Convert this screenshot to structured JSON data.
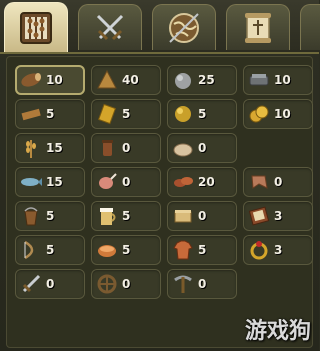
{
  "tabs": [
    {
      "name": "abacus",
      "active": true
    },
    {
      "name": "crossed-swords",
      "active": false
    },
    {
      "name": "globe",
      "active": false
    },
    {
      "name": "scroll",
      "active": false
    }
  ],
  "resources": [
    {
      "icon": "log-icon",
      "value": "10"
    },
    {
      "icon": "hide-icon",
      "value": "40"
    },
    {
      "icon": "stone-icon",
      "value": "25"
    },
    {
      "icon": "iron-icon",
      "value": "10"
    },
    {
      "icon": "plank-icon",
      "value": "5"
    },
    {
      "icon": "gold-bar-icon",
      "value": "5"
    },
    {
      "icon": "gold-ore-icon",
      "value": "5"
    },
    {
      "icon": "coins-icon",
      "value": "10"
    },
    {
      "icon": "wheat-icon",
      "value": "15"
    },
    {
      "icon": "hops-icon",
      "value": "0"
    },
    {
      "icon": "flour-icon",
      "value": "0"
    },
    {
      "icon": "fish-icon",
      "value": "15"
    },
    {
      "icon": "ham-icon",
      "value": "0"
    },
    {
      "icon": "sausage-icon",
      "value": "20"
    },
    {
      "icon": "meat-icon",
      "value": "0"
    },
    {
      "icon": "bucket-icon",
      "value": "5"
    },
    {
      "icon": "beer-icon",
      "value": "5"
    },
    {
      "icon": "cheese-icon",
      "value": "0"
    },
    {
      "icon": "book-icon",
      "value": "3"
    },
    {
      "icon": "bow-icon",
      "value": "5"
    },
    {
      "icon": "pastry-icon",
      "value": "5"
    },
    {
      "icon": "tunic-icon",
      "value": "5"
    },
    {
      "icon": "ring-icon",
      "value": "3"
    },
    {
      "icon": "sword-icon",
      "value": "0"
    },
    {
      "icon": "wheel-icon",
      "value": "0"
    },
    {
      "icon": "pickaxe-icon",
      "value": "0"
    }
  ],
  "watermark": "游戏狗",
  "colors": {
    "accent": "#b5ab6f",
    "text": "#f3efe4",
    "panel": "#2f301f"
  }
}
